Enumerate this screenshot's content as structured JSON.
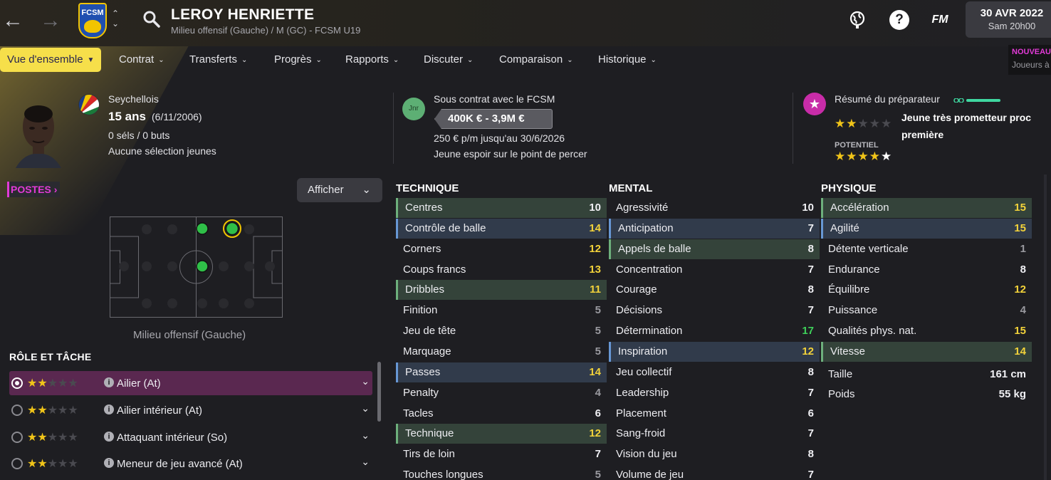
{
  "header": {
    "club_short": "FCSM",
    "player_name": "LEROY HENRIETTE",
    "player_subtitle": "Milieu offensif (Gauche) / M (GC) - FCSM U19",
    "date_main": "30 AVR 2022",
    "date_sub": "Sam 20h00",
    "fm_label": "FM",
    "help_label": "?"
  },
  "tabs": [
    {
      "label": "Vue d'ensemble"
    },
    {
      "label": "Contrat"
    },
    {
      "label": "Transferts"
    },
    {
      "label": "Progrès"
    },
    {
      "label": "Rapports"
    },
    {
      "label": "Discuter"
    },
    {
      "label": "Comparaison"
    },
    {
      "label": "Historique"
    }
  ],
  "new_badge": {
    "title": "NOUVEAU",
    "sub": "Joueurs à"
  },
  "info": {
    "nationality": "Seychellois",
    "age": "15 ans",
    "birthdate": "(6/11/2006)",
    "caps": "0 séls / 0 buts",
    "youth_caps": "Aucune sélection jeunes",
    "jnr_badge": "Jnr",
    "contract_with": "Sous contrat avec le FCSM",
    "value_range": "400K € - 3,9M €",
    "wage": "250 € p/m jusqu'au 30/6/2026",
    "status": "Jeune espoir sur le point de percer",
    "coach_summary": "Résumé du préparateur",
    "coach_report": "Jeune très prometteur proc première",
    "potential_label": "POTENTIEL",
    "ability_stars": 2,
    "potential_stars": 4.5
  },
  "left": {
    "postes_label": "POSTES",
    "afficher_label": "Afficher",
    "pitch_caption": "Milieu offensif (Gauche)",
    "role_title": "RÔLE ET TÂCHE",
    "roles": [
      {
        "name": "Ailier (At)",
        "stars": 2
      },
      {
        "name": "Ailier intérieur (At)",
        "stars": 2
      },
      {
        "name": "Attaquant intérieur (So)",
        "stars": 2
      },
      {
        "name": "Meneur de jeu avancé (At)",
        "stars": 2
      }
    ]
  },
  "attributes": {
    "technique": {
      "title": "TECHNIQUE",
      "rows": [
        {
          "name": "Centres",
          "value": "10",
          "hl": "green",
          "color": "white"
        },
        {
          "name": "Contrôle de balle",
          "value": "14",
          "hl": "blue",
          "color": "yellow"
        },
        {
          "name": "Corners",
          "value": "12",
          "hl": "",
          "color": "yellow"
        },
        {
          "name": "Coups francs",
          "value": "13",
          "hl": "",
          "color": "yellow"
        },
        {
          "name": "Dribbles",
          "value": "11",
          "hl": "green",
          "color": "yellow"
        },
        {
          "name": "Finition",
          "value": "5",
          "hl": "",
          "color": "grey"
        },
        {
          "name": "Jeu de tête",
          "value": "5",
          "hl": "",
          "color": "grey"
        },
        {
          "name": "Marquage",
          "value": "5",
          "hl": "",
          "color": "grey"
        },
        {
          "name": "Passes",
          "value": "14",
          "hl": "blue",
          "color": "yellow"
        },
        {
          "name": "Penalty",
          "value": "4",
          "hl": "",
          "color": "grey"
        },
        {
          "name": "Tacles",
          "value": "6",
          "hl": "",
          "color": "white"
        },
        {
          "name": "Technique",
          "value": "12",
          "hl": "green",
          "color": "yellow"
        },
        {
          "name": "Tirs de loin",
          "value": "7",
          "hl": "",
          "color": "white"
        },
        {
          "name": "Touches longues",
          "value": "5",
          "hl": "",
          "color": "grey"
        }
      ]
    },
    "mental": {
      "title": "MENTAL",
      "rows": [
        {
          "name": "Agressivité",
          "value": "10",
          "hl": "",
          "color": "white"
        },
        {
          "name": "Anticipation",
          "value": "7",
          "hl": "blue",
          "color": "white"
        },
        {
          "name": "Appels de balle",
          "value": "8",
          "hl": "green",
          "color": "white"
        },
        {
          "name": "Concentration",
          "value": "7",
          "hl": "",
          "color": "white"
        },
        {
          "name": "Courage",
          "value": "8",
          "hl": "",
          "color": "white"
        },
        {
          "name": "Décisions",
          "value": "7",
          "hl": "",
          "color": "white"
        },
        {
          "name": "Détermination",
          "value": "17",
          "hl": "",
          "color": "green"
        },
        {
          "name": "Inspiration",
          "value": "12",
          "hl": "blue",
          "color": "yellow"
        },
        {
          "name": "Jeu collectif",
          "value": "8",
          "hl": "",
          "color": "white"
        },
        {
          "name": "Leadership",
          "value": "7",
          "hl": "",
          "color": "white"
        },
        {
          "name": "Placement",
          "value": "6",
          "hl": "",
          "color": "white"
        },
        {
          "name": "Sang-froid",
          "value": "7",
          "hl": "",
          "color": "white"
        },
        {
          "name": "Vision du jeu",
          "value": "8",
          "hl": "",
          "color": "white"
        },
        {
          "name": "Volume de jeu",
          "value": "7",
          "hl": "",
          "color": "white"
        }
      ]
    },
    "physique": {
      "title": "PHYSIQUE",
      "rows": [
        {
          "name": "Accélération",
          "value": "15",
          "hl": "green",
          "color": "yellow"
        },
        {
          "name": "Agilité",
          "value": "15",
          "hl": "blue",
          "color": "yellow"
        },
        {
          "name": "Détente verticale",
          "value": "1",
          "hl": "",
          "color": "grey"
        },
        {
          "name": "Endurance",
          "value": "8",
          "hl": "",
          "color": "white"
        },
        {
          "name": "Équilibre",
          "value": "12",
          "hl": "",
          "color": "yellow"
        },
        {
          "name": "Puissance",
          "value": "4",
          "hl": "",
          "color": "grey"
        },
        {
          "name": "Qualités phys. nat.",
          "value": "15",
          "hl": "",
          "color": "yellow"
        },
        {
          "name": "Vitesse",
          "value": "14",
          "hl": "green",
          "color": "yellow"
        }
      ],
      "extra": [
        {
          "name": "Taille",
          "value": "161 cm"
        },
        {
          "name": "Poids",
          "value": "55 kg"
        }
      ]
    }
  },
  "colors": {
    "accent_yellow": "#f6df4a",
    "highlight_green": "#34433a",
    "highlight_blue": "#313b4b",
    "value_yellow": "#f2d23a",
    "value_green": "#3ed05a",
    "magenta": "#e23ad7"
  }
}
